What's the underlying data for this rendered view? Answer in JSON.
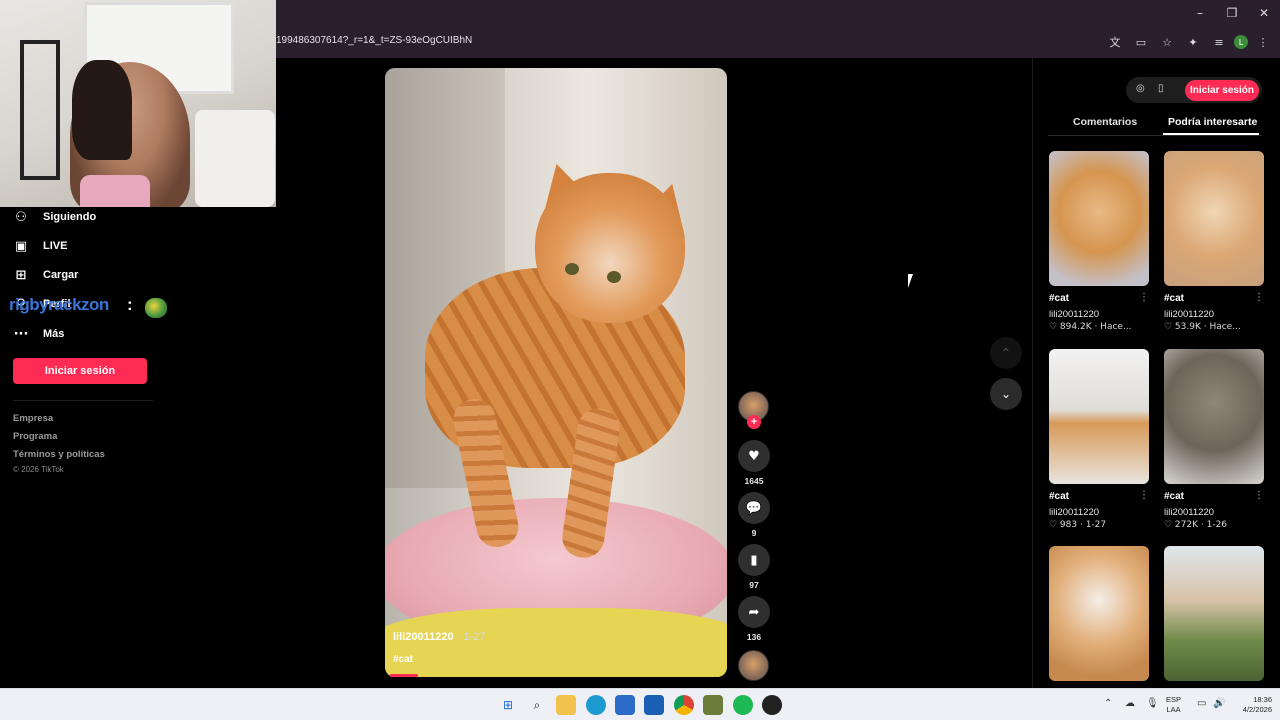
{
  "browser": {
    "url": "199486307614?_r=1&_t=ZS-93eOgCUIBhN",
    "window_controls": [
      "–",
      "❐",
      "✕"
    ],
    "icons": [
      "translate-icon",
      "cast-icon",
      "star-icon",
      "extensions-icon",
      "media-icon",
      "profile-icon",
      "menu-icon"
    ],
    "profile_initial": "L"
  },
  "sidebar": {
    "items": [
      {
        "label": "Siguiendo",
        "icon": "following-icon"
      },
      {
        "label": "LIVE",
        "icon": "live-icon"
      },
      {
        "label": "Cargar",
        "icon": "upload-icon"
      },
      {
        "label": "Perfil",
        "icon": "profile-icon"
      },
      {
        "label": "Más",
        "icon": "more-icon"
      }
    ],
    "login_label": "Iniciar sesión",
    "footer_links": [
      "Empresa",
      "Programa",
      "Términos y políticas"
    ],
    "copyright": "© 2026 TikTok"
  },
  "stream_overlay": {
    "username": "rigbyrackzon",
    "separator": ":"
  },
  "video": {
    "username": "lili20011220",
    "date": " · 1-27",
    "caption": "#cat",
    "progress_fraction": 0.08
  },
  "actions": {
    "likes": "1645",
    "comments": "9",
    "saves": "97",
    "shares": "136",
    "follow_symbol": "+"
  },
  "right_panel": {
    "login_label": "Iniciar sesión",
    "tabs": [
      "Comentarios",
      "Podría interesarte"
    ],
    "active_tab": "Podría interesarte",
    "cards": [
      {
        "tag": "#cat",
        "user": "lili20011220",
        "meta": "♡ 894.2K · Hace..."
      },
      {
        "tag": "#cat",
        "user": "lili20011220",
        "meta": "♡ 53.9K · Hace..."
      },
      {
        "tag": "#cat",
        "user": "lili20011220",
        "meta": "♡ 983 · 1-27"
      },
      {
        "tag": "#cat",
        "user": "lili20011220",
        "meta": "♡ 272K · 1-26"
      }
    ]
  },
  "taskbar": {
    "language_line1": "ESP",
    "language_line2": "LAA",
    "time": "18:36",
    "date": "4/2/2026"
  },
  "colors": {
    "accent": "#fe2c55",
    "browser_chrome": "#2a1f2c",
    "overlay_name": "#3a74d6"
  }
}
